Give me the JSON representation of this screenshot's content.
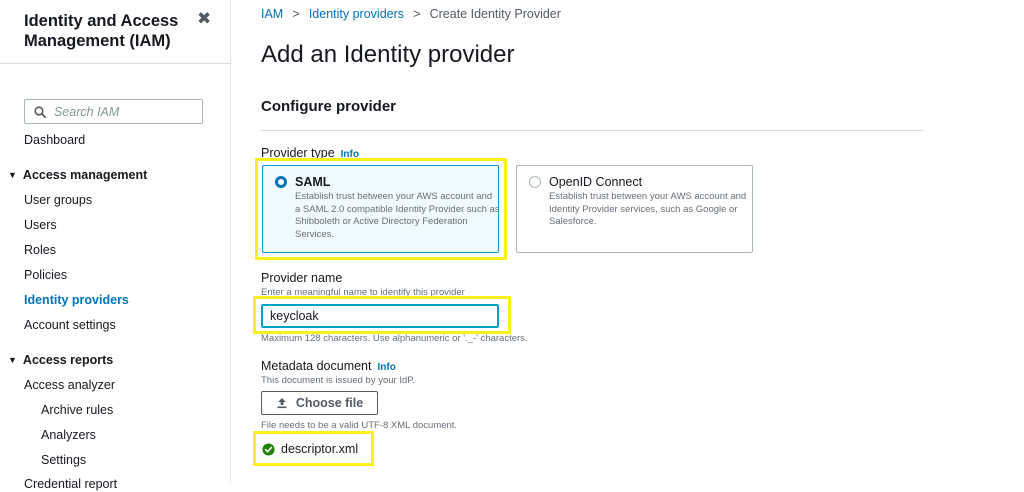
{
  "sidebar": {
    "title": "Identity and Access Management (IAM)",
    "close_glyph": "✖",
    "search_placeholder": "Search IAM",
    "dashboard": "Dashboard",
    "access_management": {
      "label": "Access management",
      "items": [
        "User groups",
        "Users",
        "Roles",
        "Policies",
        "Identity providers",
        "Account settings"
      ],
      "active": "Identity providers"
    },
    "access_reports": {
      "label": "Access reports",
      "analyzer": "Access analyzer",
      "sub_items": [
        "Archive rules",
        "Analyzers",
        "Settings"
      ],
      "next_item": "Credential report"
    }
  },
  "breadcrumb": {
    "items": [
      "IAM",
      "Identity providers"
    ],
    "current": "Create Identity Provider",
    "separator": ">"
  },
  "page_title": "Add an Identity provider",
  "section_title": "Configure provider",
  "provider_type": {
    "label": "Provider type",
    "info": "Info",
    "options": [
      {
        "name": "SAML",
        "description": "Establish trust between your AWS account and a SAML 2.0 compatible Identity Provider such as Shibboleth or Active Directory Federation Services.",
        "selected": true
      },
      {
        "name": "OpenID Connect",
        "description": "Establish trust between your AWS account and Identity Provider services, such as Google or Salesforce.",
        "selected": false
      }
    ]
  },
  "provider_name": {
    "label": "Provider name",
    "hint": "Enter a meaningful name to identify this provider",
    "value": "keycloak",
    "constraint": "Maximum 128 characters. Use alphanumeric or '._-' characters."
  },
  "metadata_document": {
    "label": "Metadata document",
    "info": "Info",
    "hint": "This document is issued by your IdP.",
    "button_label": "Choose file",
    "constraint": "File needs to be a valid UTF-8 XML document.",
    "file_name": "descriptor.xml"
  },
  "colors": {
    "link": "#0073bb",
    "highlight": "#f8f21a",
    "selected_tile_bg": "#f1faff",
    "success": "#1d8102"
  },
  "icons": {
    "search": "search-icon",
    "close": "close-icon",
    "caret": "caret-down-icon",
    "upload": "upload-icon",
    "success": "check-circle-icon"
  }
}
